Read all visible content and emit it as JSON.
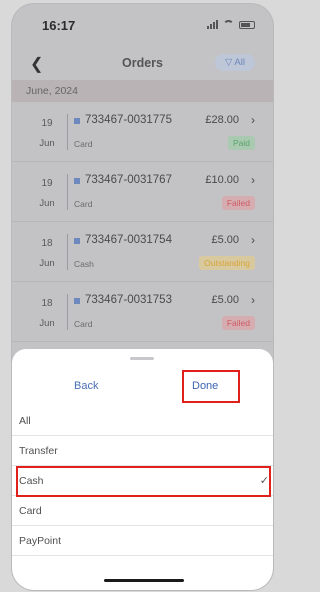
{
  "status_bar": {
    "time": "16:17"
  },
  "nav": {
    "back_icon": "chevron-left-icon",
    "title": "Orders",
    "filter_label": "▽ All"
  },
  "month_header": "June, 2024",
  "orders": [
    {
      "day": "19",
      "month": "Jun",
      "ref": "733467-0031775",
      "method": "Card",
      "amount": "£28.00",
      "status": "Paid",
      "status_bg": "#a9c9b0",
      "status_color": "#5aa46b"
    },
    {
      "day": "19",
      "month": "Jun",
      "ref": "733467-0031767",
      "method": "Card",
      "amount": "£10.00",
      "status": "Failed",
      "status_bg": "#d5adb1",
      "status_color": "#cf5a62"
    },
    {
      "day": "18",
      "month": "Jun",
      "ref": "733467-0031754",
      "method": "Cash",
      "amount": "£5.00",
      "status": "Outstanding",
      "status_bg": "#d9c99e",
      "status_color": "#d7a43a"
    },
    {
      "day": "18",
      "month": "Jun",
      "ref": "733467-0031753",
      "method": "Card",
      "amount": "£5.00",
      "status": "Failed",
      "status_bg": "#d5adb1",
      "status_color": "#cf5a62"
    }
  ],
  "sheet": {
    "back_label": "Back",
    "done_label": "Done",
    "options": [
      {
        "label": "All",
        "selected": false
      },
      {
        "label": "Transfer",
        "selected": false
      },
      {
        "label": "Cash",
        "selected": true,
        "check": "✓"
      },
      {
        "label": "Card",
        "selected": false
      },
      {
        "label": "PayPoint",
        "selected": false
      }
    ]
  }
}
